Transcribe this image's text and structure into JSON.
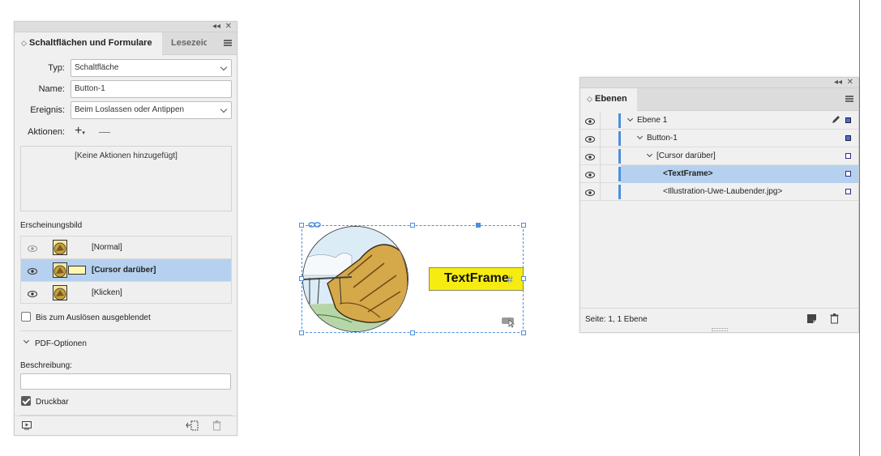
{
  "buttons_panel": {
    "tab_active": "Schaltflächen und Formulare",
    "tab_inactive": "Lesezeic",
    "type_label": "Typ:",
    "type_value": "Schaltfläche",
    "name_label": "Name:",
    "name_value": "Button-1",
    "event_label": "Ereignis:",
    "event_value": "Beim Loslassen oder Antippen",
    "actions_label": "Aktionen:",
    "actions_empty": "[Keine Aktionen hinzugefügt]",
    "appearance_label": "Erscheinungsbild",
    "states": [
      {
        "label": "[Normal]",
        "selected": false
      },
      {
        "label": "[Cursor darüber]",
        "selected": true
      },
      {
        "label": "[Klicken]",
        "selected": false
      }
    ],
    "hidden_until_triggered": "Bis zum Auslösen ausgeblendet",
    "pdf_options": "PDF-Optionen",
    "description_label": "Beschreibung:",
    "printable": "Druckbar"
  },
  "canvas": {
    "textframe_text": "TextFrame",
    "textframe_hash": "#"
  },
  "layers_panel": {
    "tab": "Ebenen",
    "layers": [
      {
        "label": "Ebene 1",
        "indent": 0,
        "twisty": true
      },
      {
        "label": "Button-1",
        "indent": 1,
        "twisty": true
      },
      {
        "label": "[Cursor darüber]",
        "indent": 2,
        "twisty": true
      },
      {
        "label": "<TextFrame>",
        "indent": 3,
        "twisty": false
      },
      {
        "label": "<Illustration-Uwe-Laubender.jpg>",
        "indent": 3,
        "twisty": false
      }
    ],
    "footer": "Seite: 1, 1 Ebene"
  },
  "colors": {
    "selection": "#b6d1ef",
    "frame_blue": "#4c8fe0",
    "textframe_fill": "#f6ec10",
    "guide_purple": "#b54cc7"
  }
}
